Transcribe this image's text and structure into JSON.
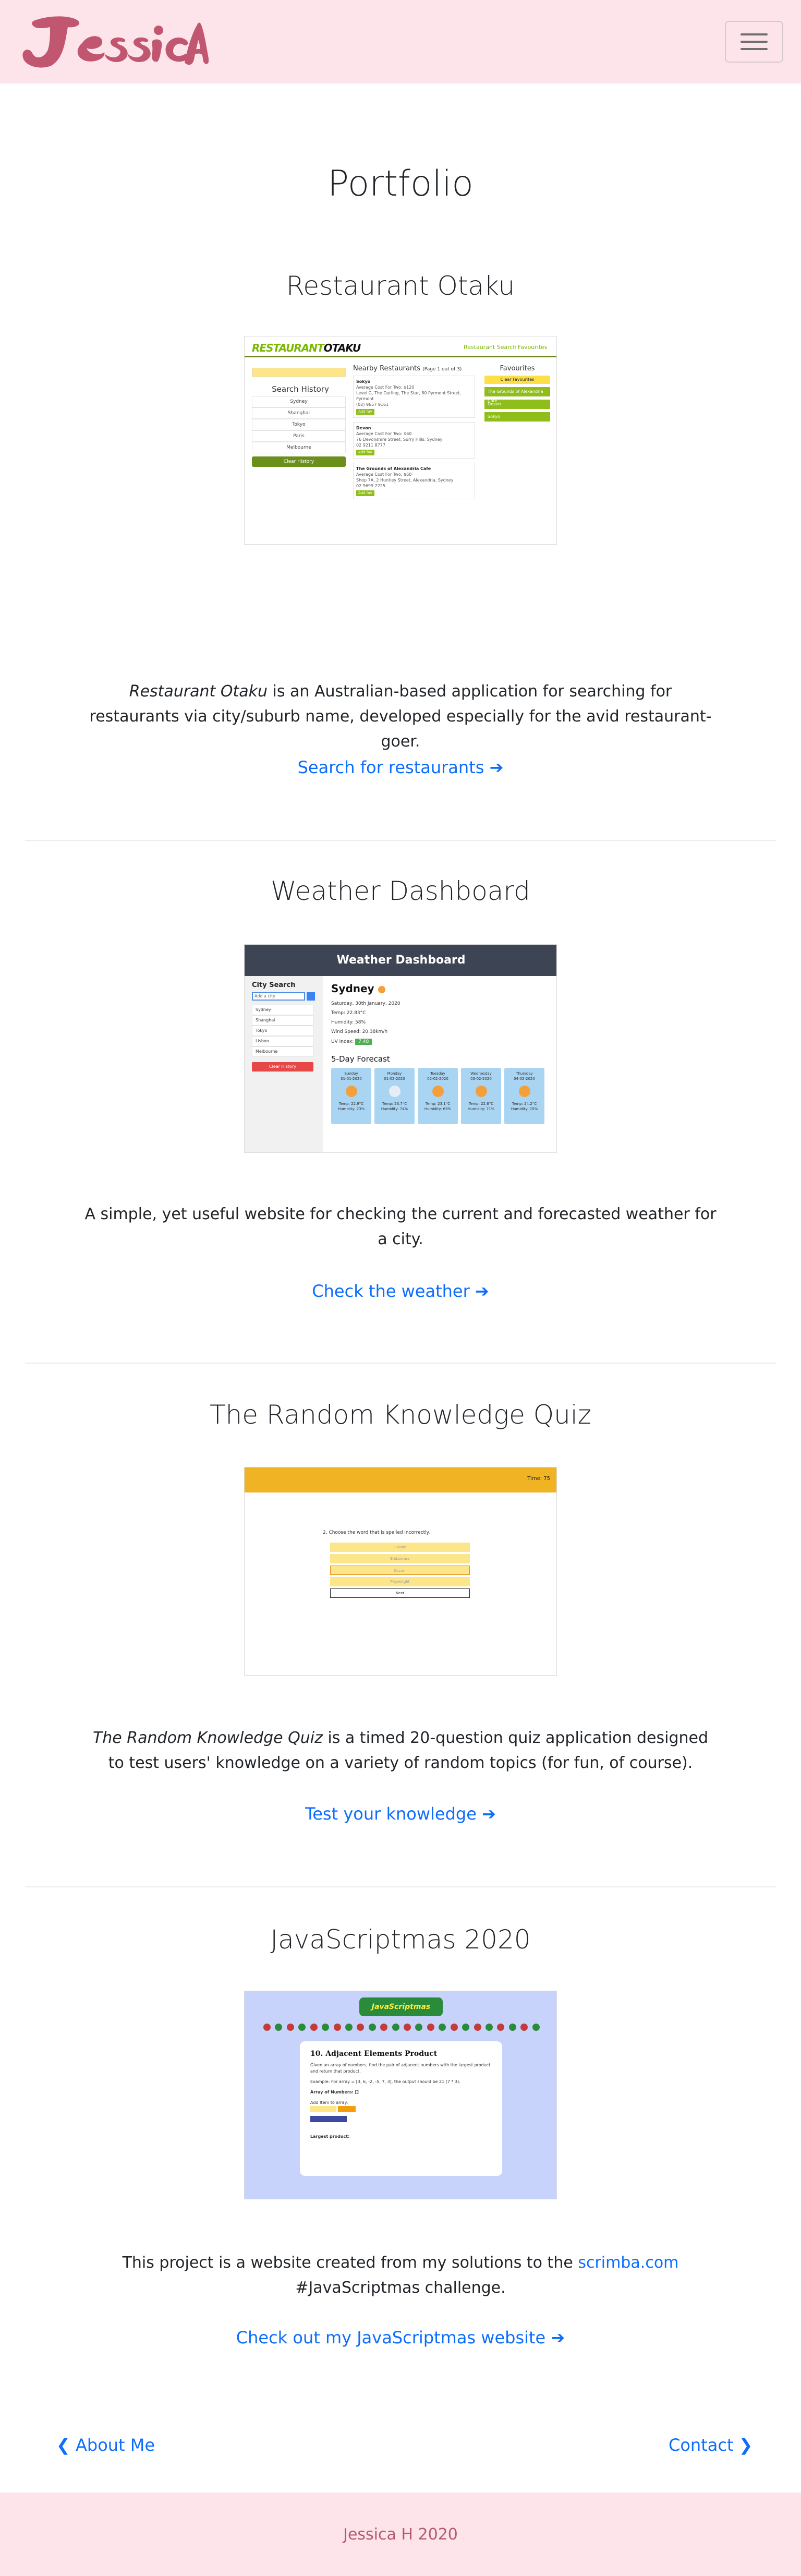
{
  "navbar": {
    "logo_text": "Jessica",
    "menu_icon": "hamburger-menu-icon"
  },
  "page": {
    "title": "Portfolio"
  },
  "projects": [
    {
      "title": "Restaurant Otaku",
      "description_em": "Restaurant Otaku",
      "description_rest": " is an Australian-based application for searching for restaurants via city/suburb name, developed especially for the avid restaurant-goer.",
      "link_text": "Search for restaurants",
      "preview": {
        "logo_a": "RESTAURANT",
        "logo_b": "OTAKU",
        "nav_search": "Restaurant Search",
        "nav_fav": "Favourites",
        "search_history_heading": "Search History",
        "cities": [
          "Sydney",
          "Shanghai",
          "Tokyo",
          "Paris",
          "Melbourne"
        ],
        "clear_label": "Clear History",
        "nearby_heading": "Nearby Restaurants",
        "nearby_page": "(Page 1 out of 3)",
        "cards": [
          {
            "name": "Sokyo",
            "cost": "Average Cost For Two: $120",
            "address": "Level G, The Darling, The Star, 80 Pyrmont Street, Pyrmont",
            "phone": "(02) 9657 9161",
            "tag": "Add fav"
          },
          {
            "name": "Devon",
            "cost": "Average Cost For Two: $60",
            "address": "76 Devonshire Street, Surry Hills, Sydney",
            "phone": "02 9211 8777",
            "tag": "Add fav"
          },
          {
            "name": "The Grounds of Alexandria Cafe",
            "cost": "Average Cost For Two: $60",
            "address": "Shop 7A, 2 Huntley Street, Alexandria, Sydney",
            "phone": "02 9699 2225",
            "tag": "Add fav"
          }
        ],
        "fav_heading": "Favourites",
        "fav_button": "Clear Favourites",
        "fav_items": [
          "The Grounds of Alexandria Cafe",
          "Devon",
          "Sokyo"
        ]
      }
    },
    {
      "title": "Weather Dashboard",
      "description": "A simple, yet useful website for checking the current and forecasted weather for a city.",
      "link_text": "Check the weather",
      "preview": {
        "header": "Weather Dashboard",
        "city_search": "City Search",
        "input_placeholder": "Add a city",
        "cities": [
          "Sydney",
          "Shanghai",
          "Tokyo",
          "Lisbon",
          "Melbourne"
        ],
        "clear_label": "Clear History",
        "city": "Sydney",
        "date": "Saturday, 30th January, 2020",
        "temp": "Temp: 22.83°C",
        "humidity": "Humidity: 58%",
        "wind": "Wind Speed: 20.38km/h",
        "uv_label": "UV Index:",
        "uv_value": "7.48",
        "forecast_heading": "5-Day Forecast",
        "days": [
          {
            "day": "Sunday",
            "date": "31-01-2020",
            "temp": "Temp: 22.9°C",
            "hum": "Humidity: 73%"
          },
          {
            "day": "Monday",
            "date": "01-02-2020",
            "temp": "Temp: 23.7°C",
            "hum": "Humidity: 74%"
          },
          {
            "day": "Tuesday",
            "date": "02-02-2020",
            "temp": "Temp: 23.1°C",
            "hum": "Humidity: 69%"
          },
          {
            "day": "Wednesday",
            "date": "03-02-2020",
            "temp": "Temp: 22.8°C",
            "hum": "Humidity: 71%"
          },
          {
            "day": "Thursday",
            "date": "04-02-2020",
            "temp": "Temp: 24.2°C",
            "hum": "Humidity: 70%"
          }
        ]
      }
    },
    {
      "title": "The Random Knowledge Quiz",
      "description_em": "The Random Knowledge Quiz",
      "description_rest": " is a timed 20-question quiz application designed to test users' knowledge on a variety of random topics (for fun, of course).",
      "link_text": "Test your knowledge",
      "preview": {
        "timer": "Time: 75",
        "question": "2. Choose the word that is spelled incorrectly.",
        "options": [
          "Liaison",
          "Embarrass",
          "Occurr",
          "Playwright"
        ],
        "next_label": "Next"
      }
    },
    {
      "title": "JavaScriptmas 2020",
      "description_a": "This project is a website created from my solutions to the ",
      "description_link": "scrimba.com",
      "description_b": " #JavaScriptmas challenge.",
      "link_text": "Check out my JavaScriptmas website",
      "preview": {
        "logo": "JavaScriptmas",
        "heading": "10. Adjacent Elements Product",
        "intro": "Given an array of numbers, find the pair of adjacent numbers with the largest product and return that product.",
        "example": "Example: For array = [3, 6, -2, -5, 7, 3], the output should be 21 (7 * 3).",
        "array_label": "Array of Numbers: []",
        "add_label": "Add Item to array:",
        "btn_add": "Add",
        "btn_find": "Find largest product",
        "result_label": "Largest product:"
      }
    }
  ],
  "bottom_nav": {
    "prev": "About Me",
    "next": "Contact"
  },
  "footer": {
    "text": "Jessica H 2020"
  },
  "colors": {
    "brand_pink": "#fde4ea",
    "logo_rose": "#c0566f",
    "link_blue": "#0d6efd"
  }
}
